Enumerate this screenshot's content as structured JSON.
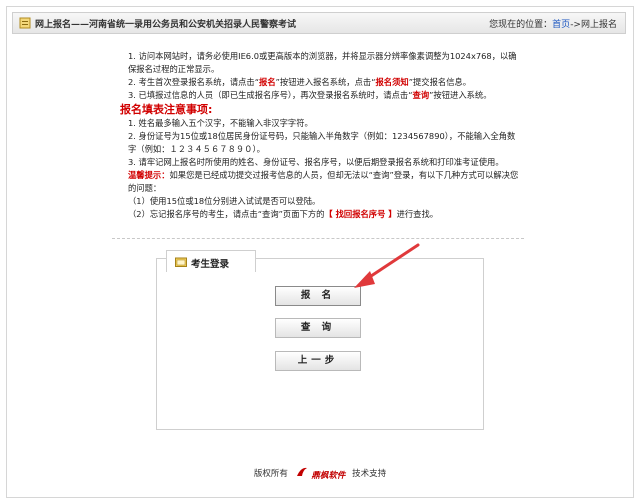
{
  "header": {
    "title": "网上报名——河南省统一录用公务员和公安机关招录人民警察考试",
    "crumb_prefix": "您现在的位置：",
    "crumb_home": "首页",
    "crumb_sep": "->",
    "crumb_current": "网上报名"
  },
  "notes": {
    "n1": "1. 访问本网站时，请务必使用IE6.0或更高版本的浏览器，并将显示器分辨率像素调整为1024x768，以确保报名过程的正常显示。",
    "n2_a": "2. 考生首次登录报名系统，请点击“",
    "n2_b": "报名",
    "n2_c": "”按钮进入报名系统，点击“",
    "n2_d": "报名须知",
    "n2_e": "”提交报名信息。",
    "n3_a": "3. 已填报过信息的人员（即已生成报名序号），再次登录报名系统时，请点击“",
    "n3_b": "查询",
    "n3_c": "”按钮进入系统。",
    "notice_title": "报名填表注意事项:",
    "m1": "1. 姓名最多输入五个汉字，不能输入非汉字字符。",
    "m2": "2. 身份证号为15位或18位居民身份证号码，只能输入半角数字（例如：1234567890），不能输入全角数字（例如：１２３４５６７８９０）。",
    "m3": "3. 请牢记网上报名时所使用的姓名、身份证号、报名序号，以便后期登录报名系统和打印准考证使用。",
    "tip_label": "温馨提示：",
    "tip_text": "如果您是已经成功提交过报考信息的人员，但却无法以“查询”登录，有以下几种方式可以解决您的问题：",
    "t1": "（1）使用15位或18位分别进入试试是否可以登陆。",
    "t2_a": "（2）忘记报名序号的考生，请点击“查询”页面下方的",
    "t2_b": "【 找回报名序号 】",
    "t2_c": "进行查找。"
  },
  "login": {
    "title": "考生登录",
    "btn_register": "报 名",
    "btn_query": "查 询",
    "btn_back": "上一步"
  },
  "footer": {
    "copyright": "版权所有",
    "brand": "鼎枫软件",
    "support": "技术支持"
  },
  "colors": {
    "accent_red": "#d10000",
    "link_blue": "#1a55c0",
    "arrow": "#e0393b"
  }
}
